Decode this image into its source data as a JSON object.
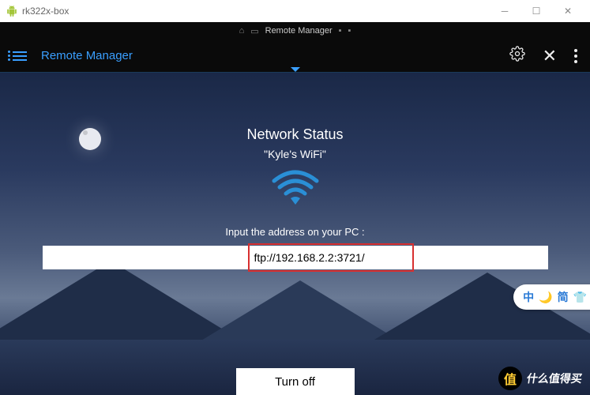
{
  "window": {
    "title": "rk322x-box"
  },
  "statusBar": {
    "label": "Remote Manager"
  },
  "appBar": {
    "title": "Remote Manager"
  },
  "content": {
    "networkStatusLabel": "Network Status",
    "wifiName": "\"Kyle's WiFi\"",
    "inputLabel": "Input the address on your PC :",
    "ftpAddress": "ftp://192.168.2.2:3721/",
    "turnOffLabel": "Turn off"
  },
  "ime": {
    "char1": "中",
    "char2": "简"
  },
  "watermark": {
    "badge": "值",
    "text": "什么值得买"
  }
}
